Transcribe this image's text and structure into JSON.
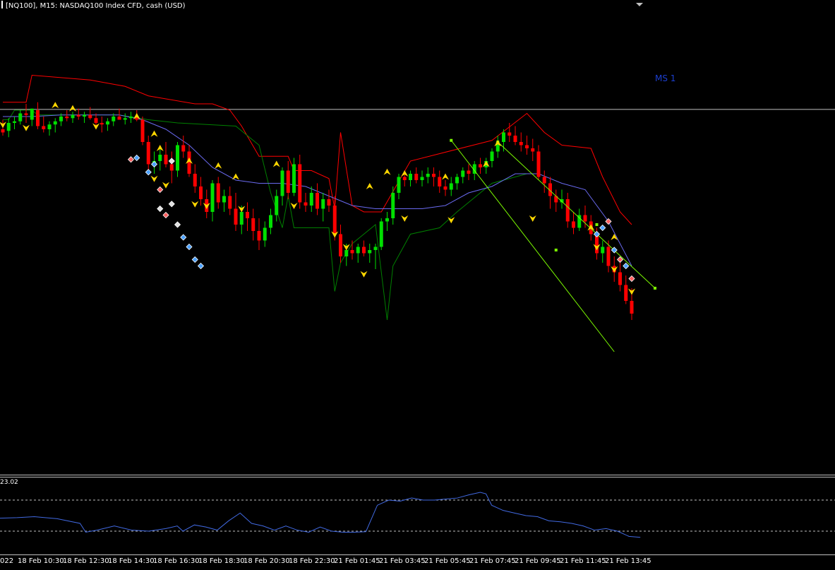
{
  "header": {
    "title": "[NQ100], M15:  NASDAQ100 Index CFD, cash (USD)"
  },
  "level_label": "MS 1",
  "indicator_value": "23.02",
  "xaxis": {
    "left_clip": "022",
    "labels": [
      "18 Feb 10:30",
      "18 Feb 12:30",
      "18 Feb 14:30",
      "18 Feb 16:30",
      "18 Feb 18:30",
      "18 Feb 20:30",
      "18 Feb 22:30",
      "21 Feb 01:45",
      "21 Feb 03:45",
      "21 Feb 05:45",
      "21 Feb 07:45",
      "21 Feb 09:45",
      "21 Feb 11:45",
      "21 Feb 13:45"
    ]
  },
  "colors": {
    "bull": "#00e000",
    "bear": "#ff0000",
    "upper_band": "#ff0000",
    "lower_band": "#008000",
    "ma": "#6a6af0",
    "channel": "#7cfc00",
    "arrow": "#ffd700",
    "indicator": "#4169e1",
    "level": "#c0c0c0"
  },
  "chart_data": {
    "type": "candlestick",
    "y_scale": [
      0,
      100
    ],
    "level_y": 92.5,
    "candles": [
      [
        0,
        80,
        86,
        76,
        78
      ],
      [
        1,
        79,
        87,
        75,
        84
      ],
      [
        2,
        84,
        88,
        80,
        85
      ],
      [
        3,
        85,
        92,
        83,
        90
      ],
      [
        4,
        90,
        96,
        84,
        89
      ],
      [
        5,
        86,
        93,
        82,
        93
      ],
      [
        6,
        92,
        97,
        80,
        82
      ],
      [
        7,
        82,
        88,
        78,
        80
      ],
      [
        8,
        80,
        85,
        76,
        83
      ],
      [
        9,
        83,
        87,
        78,
        85
      ],
      [
        10,
        85,
        90,
        82,
        88
      ],
      [
        11,
        88,
        92,
        85,
        87
      ],
      [
        12,
        87,
        91,
        84,
        89
      ],
      [
        13,
        89,
        93,
        86,
        88
      ],
      [
        14,
        88,
        91,
        84,
        89
      ],
      [
        15,
        89,
        94,
        86,
        87
      ],
      [
        16,
        87,
        90,
        82,
        84
      ],
      [
        17,
        84,
        88,
        78,
        83
      ],
      [
        18,
        83,
        87,
        79,
        85
      ],
      [
        19,
        85,
        90,
        82,
        88
      ],
      [
        20,
        88,
        93,
        86,
        86
      ],
      [
        21,
        86,
        90,
        83,
        87
      ],
      [
        22,
        87,
        91,
        84,
        88
      ],
      [
        23,
        88,
        92,
        85,
        86
      ],
      [
        24,
        86,
        88,
        70,
        72
      ],
      [
        25,
        72,
        76,
        54,
        58
      ],
      [
        26,
        58,
        66,
        52,
        60
      ],
      [
        27,
        60,
        68,
        54,
        64
      ],
      [
        28,
        64,
        72,
        56,
        58
      ],
      [
        29,
        58,
        66,
        46,
        54
      ],
      [
        30,
        54,
        72,
        50,
        70
      ],
      [
        31,
        70,
        76,
        62,
        66
      ],
      [
        32,
        66,
        70,
        50,
        52
      ],
      [
        33,
        52,
        58,
        40,
        44
      ],
      [
        34,
        44,
        50,
        32,
        36
      ],
      [
        35,
        36,
        42,
        24,
        28
      ],
      [
        36,
        28,
        48,
        22,
        46
      ],
      [
        37,
        46,
        50,
        30,
        34
      ],
      [
        38,
        34,
        42,
        28,
        38
      ],
      [
        39,
        38,
        44,
        26,
        30
      ],
      [
        40,
        30,
        40,
        16,
        20
      ],
      [
        41,
        20,
        32,
        14,
        28
      ],
      [
        42,
        28,
        34,
        16,
        24
      ],
      [
        43,
        24,
        30,
        10,
        16
      ],
      [
        44,
        16,
        24,
        4,
        10
      ],
      [
        45,
        10,
        22,
        6,
        18
      ],
      [
        46,
        18,
        30,
        14,
        26
      ],
      [
        47,
        26,
        42,
        22,
        38
      ],
      [
        48,
        38,
        56,
        32,
        54
      ],
      [
        49,
        54,
        60,
        36,
        40
      ],
      [
        50,
        40,
        62,
        38,
        58
      ],
      [
        51,
        58,
        64,
        30,
        34
      ],
      [
        52,
        34,
        40,
        28,
        32
      ],
      [
        53,
        32,
        44,
        28,
        40
      ],
      [
        54,
        40,
        46,
        26,
        30
      ],
      [
        55,
        30,
        40,
        22,
        36
      ],
      [
        56,
        36,
        42,
        28,
        32
      ],
      [
        57,
        32,
        38,
        10,
        14
      ],
      [
        58,
        14,
        20,
        -4,
        0
      ],
      [
        59,
        0,
        8,
        -6,
        4
      ],
      [
        60,
        4,
        10,
        -2,
        2
      ],
      [
        61,
        2,
        8,
        -4,
        6
      ],
      [
        62,
        6,
        10,
        0,
        2
      ],
      [
        63,
        2,
        8,
        -4,
        4
      ],
      [
        64,
        4,
        8,
        -8,
        6
      ],
      [
        65,
        6,
        24,
        4,
        22
      ],
      [
        66,
        22,
        28,
        16,
        24
      ],
      [
        67,
        24,
        44,
        20,
        40
      ],
      [
        68,
        40,
        52,
        36,
        50
      ],
      [
        69,
        50,
        54,
        44,
        48
      ],
      [
        70,
        48,
        54,
        44,
        52
      ],
      [
        71,
        52,
        56,
        46,
        48
      ],
      [
        72,
        48,
        54,
        44,
        50
      ],
      [
        73,
        50,
        56,
        46,
        52
      ],
      [
        74,
        52,
        56,
        44,
        50
      ],
      [
        75,
        50,
        54,
        40,
        44
      ],
      [
        76,
        44,
        48,
        38,
        42
      ],
      [
        77,
        42,
        50,
        38,
        46
      ],
      [
        78,
        46,
        52,
        42,
        50
      ],
      [
        79,
        50,
        56,
        46,
        54
      ],
      [
        80,
        54,
        58,
        48,
        52
      ],
      [
        81,
        52,
        60,
        48,
        58
      ],
      [
        82,
        58,
        62,
        52,
        56
      ],
      [
        83,
        56,
        62,
        52,
        60
      ],
      [
        84,
        60,
        68,
        56,
        66
      ],
      [
        85,
        66,
        76,
        62,
        72
      ],
      [
        86,
        72,
        80,
        66,
        78
      ],
      [
        87,
        78,
        84,
        72,
        76
      ],
      [
        88,
        76,
        82,
        70,
        72
      ],
      [
        89,
        72,
        78,
        66,
        70
      ],
      [
        90,
        70,
        76,
        64,
        68
      ],
      [
        91,
        68,
        74,
        60,
        66
      ],
      [
        92,
        66,
        70,
        48,
        50
      ],
      [
        93,
        50,
        54,
        40,
        46
      ],
      [
        94,
        46,
        50,
        30,
        38
      ],
      [
        95,
        38,
        42,
        28,
        34
      ],
      [
        96,
        34,
        42,
        30,
        36
      ],
      [
        97,
        36,
        40,
        18,
        22
      ],
      [
        98,
        22,
        28,
        14,
        18
      ],
      [
        99,
        18,
        30,
        16,
        26
      ],
      [
        100,
        26,
        32,
        18,
        22
      ],
      [
        101,
        22,
        26,
        10,
        14
      ],
      [
        102,
        14,
        18,
        -2,
        2
      ],
      [
        103,
        2,
        10,
        -4,
        6
      ],
      [
        104,
        6,
        10,
        -10,
        -6
      ],
      [
        105,
        -6,
        0,
        -16,
        -10
      ],
      [
        106,
        -10,
        -4,
        -22,
        -18
      ],
      [
        107,
        -18,
        -12,
        -30,
        -28
      ],
      [
        108,
        -28,
        -20,
        -40,
        -36
      ]
    ],
    "upper_band": [
      [
        0,
        97
      ],
      [
        4,
        97
      ],
      [
        5,
        114
      ],
      [
        15,
        111
      ],
      [
        21,
        107
      ],
      [
        25,
        101
      ],
      [
        33,
        96
      ],
      [
        36,
        96
      ],
      [
        39,
        92
      ],
      [
        41,
        82
      ],
      [
        44,
        63
      ],
      [
        49,
        63
      ],
      [
        50,
        54
      ],
      [
        53,
        54
      ],
      [
        56,
        49
      ],
      [
        57,
        30
      ],
      [
        58,
        78
      ],
      [
        60,
        32
      ],
      [
        62,
        28
      ],
      [
        65,
        28
      ],
      [
        70,
        60
      ],
      [
        84,
        73
      ],
      [
        90,
        90
      ],
      [
        93,
        78
      ],
      [
        96,
        70
      ],
      [
        101,
        68
      ],
      [
        103,
        50
      ],
      [
        106,
        28
      ],
      [
        108,
        20
      ]
    ],
    "lower_band": [
      [
        0,
        86
      ],
      [
        1,
        86
      ],
      [
        2,
        92
      ],
      [
        5,
        92
      ],
      [
        6,
        89
      ],
      [
        20,
        89
      ],
      [
        25,
        86
      ],
      [
        30,
        84
      ],
      [
        40,
        82
      ],
      [
        44,
        70
      ],
      [
        46,
        40
      ],
      [
        48,
        18
      ],
      [
        49,
        38
      ],
      [
        50,
        18
      ],
      [
        56,
        18
      ],
      [
        57,
        -22
      ],
      [
        58,
        -4
      ],
      [
        60,
        8
      ],
      [
        64,
        20
      ],
      [
        66,
        -40
      ],
      [
        67,
        -6
      ],
      [
        70,
        14
      ],
      [
        75,
        18
      ],
      [
        78,
        28
      ],
      [
        84,
        46
      ],
      [
        90,
        52
      ],
      [
        92,
        52
      ]
    ],
    "ma": [
      [
        0,
        88
      ],
      [
        5,
        88
      ],
      [
        10,
        89
      ],
      [
        20,
        89
      ],
      [
        24,
        86
      ],
      [
        28,
        80
      ],
      [
        32,
        70
      ],
      [
        36,
        56
      ],
      [
        40,
        48
      ],
      [
        44,
        46
      ],
      [
        48,
        46
      ],
      [
        52,
        44
      ],
      [
        56,
        38
      ],
      [
        60,
        32
      ],
      [
        64,
        30
      ],
      [
        68,
        30
      ],
      [
        72,
        30
      ],
      [
        76,
        32
      ],
      [
        80,
        40
      ],
      [
        84,
        44
      ],
      [
        88,
        52
      ],
      [
        92,
        52
      ],
      [
        96,
        46
      ],
      [
        100,
        42
      ],
      [
        104,
        22
      ],
      [
        108,
        -6
      ]
    ],
    "channel": {
      "upper": [
        [
          85,
          72
        ],
        [
          112,
          -20
        ]
      ],
      "lower": [
        [
          77,
          73
        ],
        [
          105,
          -60
        ]
      ],
      "handles": [
        [
          77,
          73
        ],
        [
          95,
          4
        ],
        [
          85,
          72
        ],
        [
          102,
          20
        ],
        [
          112,
          -20
        ]
      ]
    },
    "arrows_up": [
      [
        9,
        95
      ],
      [
        12,
        93
      ],
      [
        23,
        88
      ],
      [
        26,
        77
      ],
      [
        27,
        68
      ],
      [
        32,
        60
      ],
      [
        37,
        57
      ],
      [
        40,
        50
      ],
      [
        47,
        58
      ],
      [
        63,
        44
      ],
      [
        66,
        53
      ],
      [
        69,
        52
      ],
      [
        76,
        50
      ],
      [
        83,
        58
      ],
      [
        85,
        71
      ],
      [
        101,
        18
      ],
      [
        105,
        12
      ]
    ],
    "arrows_down": [
      [
        0,
        83
      ],
      [
        4,
        81
      ],
      [
        16,
        82
      ],
      [
        26,
        49
      ],
      [
        28,
        45
      ],
      [
        33,
        33
      ],
      [
        35,
        32
      ],
      [
        41,
        30
      ],
      [
        50,
        32
      ],
      [
        57,
        14
      ],
      [
        59,
        6
      ],
      [
        62,
        -11
      ],
      [
        69,
        24
      ],
      [
        77,
        23
      ],
      [
        91,
        24
      ],
      [
        102,
        6
      ],
      [
        105,
        -8
      ],
      [
        108,
        -22
      ]
    ],
    "signals": [
      [
        22,
        61,
        "#ff6060"
      ],
      [
        23,
        62,
        "#4aa0ff"
      ],
      [
        25,
        53,
        "#4aa0ff"
      ],
      [
        26,
        58,
        "#4aa0ff"
      ],
      [
        27,
        42,
        "#ff6060"
      ],
      [
        27,
        30,
        "#e0e0e0"
      ],
      [
        28,
        26,
        "#ff6060"
      ],
      [
        29,
        60,
        "#e0e0e0"
      ],
      [
        29,
        33,
        "#e0e0e0"
      ],
      [
        30,
        20,
        "#e0e0e0"
      ],
      [
        31,
        12,
        "#4aa0ff"
      ],
      [
        32,
        6,
        "#4aa0ff"
      ],
      [
        33,
        -2,
        "#4aa0ff"
      ],
      [
        34,
        -6,
        "#4aa0ff"
      ],
      [
        104,
        22,
        "#ff6060"
      ],
      [
        103,
        18,
        "#4aa0ff"
      ],
      [
        102,
        14,
        "#4aa0ff"
      ],
      [
        105,
        4,
        "#4aa0ff"
      ],
      [
        106,
        -2,
        "#ff6060"
      ],
      [
        107,
        -6,
        "#4aa0ff"
      ],
      [
        108,
        -14,
        "#ff6060"
      ]
    ],
    "indicator": {
      "levels": [
        80,
        20
      ],
      "values": [
        [
          0,
          45
        ],
        [
          6,
          46
        ],
        [
          12,
          48
        ],
        [
          20,
          44
        ],
        [
          28,
          35
        ],
        [
          30,
          18
        ],
        [
          34,
          22
        ],
        [
          40,
          30
        ],
        [
          46,
          22
        ],
        [
          52,
          20
        ],
        [
          58,
          25
        ],
        [
          62,
          30
        ],
        [
          64,
          20
        ],
        [
          68,
          32
        ],
        [
          72,
          28
        ],
        [
          76,
          22
        ],
        [
          80,
          40
        ],
        [
          84,
          55
        ],
        [
          88,
          35
        ],
        [
          92,
          30
        ],
        [
          96,
          22
        ],
        [
          100,
          30
        ],
        [
          104,
          22
        ],
        [
          108,
          18
        ],
        [
          112,
          28
        ],
        [
          116,
          20
        ],
        [
          120,
          18
        ],
        [
          124,
          18
        ],
        [
          128,
          19
        ],
        [
          132,
          70
        ],
        [
          136,
          80
        ],
        [
          140,
          78
        ],
        [
          144,
          84
        ],
        [
          148,
          80
        ],
        [
          152,
          80
        ],
        [
          156,
          82
        ],
        [
          160,
          84
        ],
        [
          164,
          90
        ],
        [
          168,
          95
        ],
        [
          170,
          92
        ],
        [
          172,
          70
        ],
        [
          176,
          60
        ],
        [
          180,
          55
        ],
        [
          184,
          50
        ],
        [
          188,
          48
        ],
        [
          192,
          40
        ],
        [
          196,
          38
        ],
        [
          200,
          35
        ],
        [
          204,
          30
        ],
        [
          208,
          22
        ],
        [
          212,
          25
        ],
        [
          216,
          20
        ],
        [
          220,
          10
        ],
        [
          224,
          8
        ]
      ]
    }
  }
}
